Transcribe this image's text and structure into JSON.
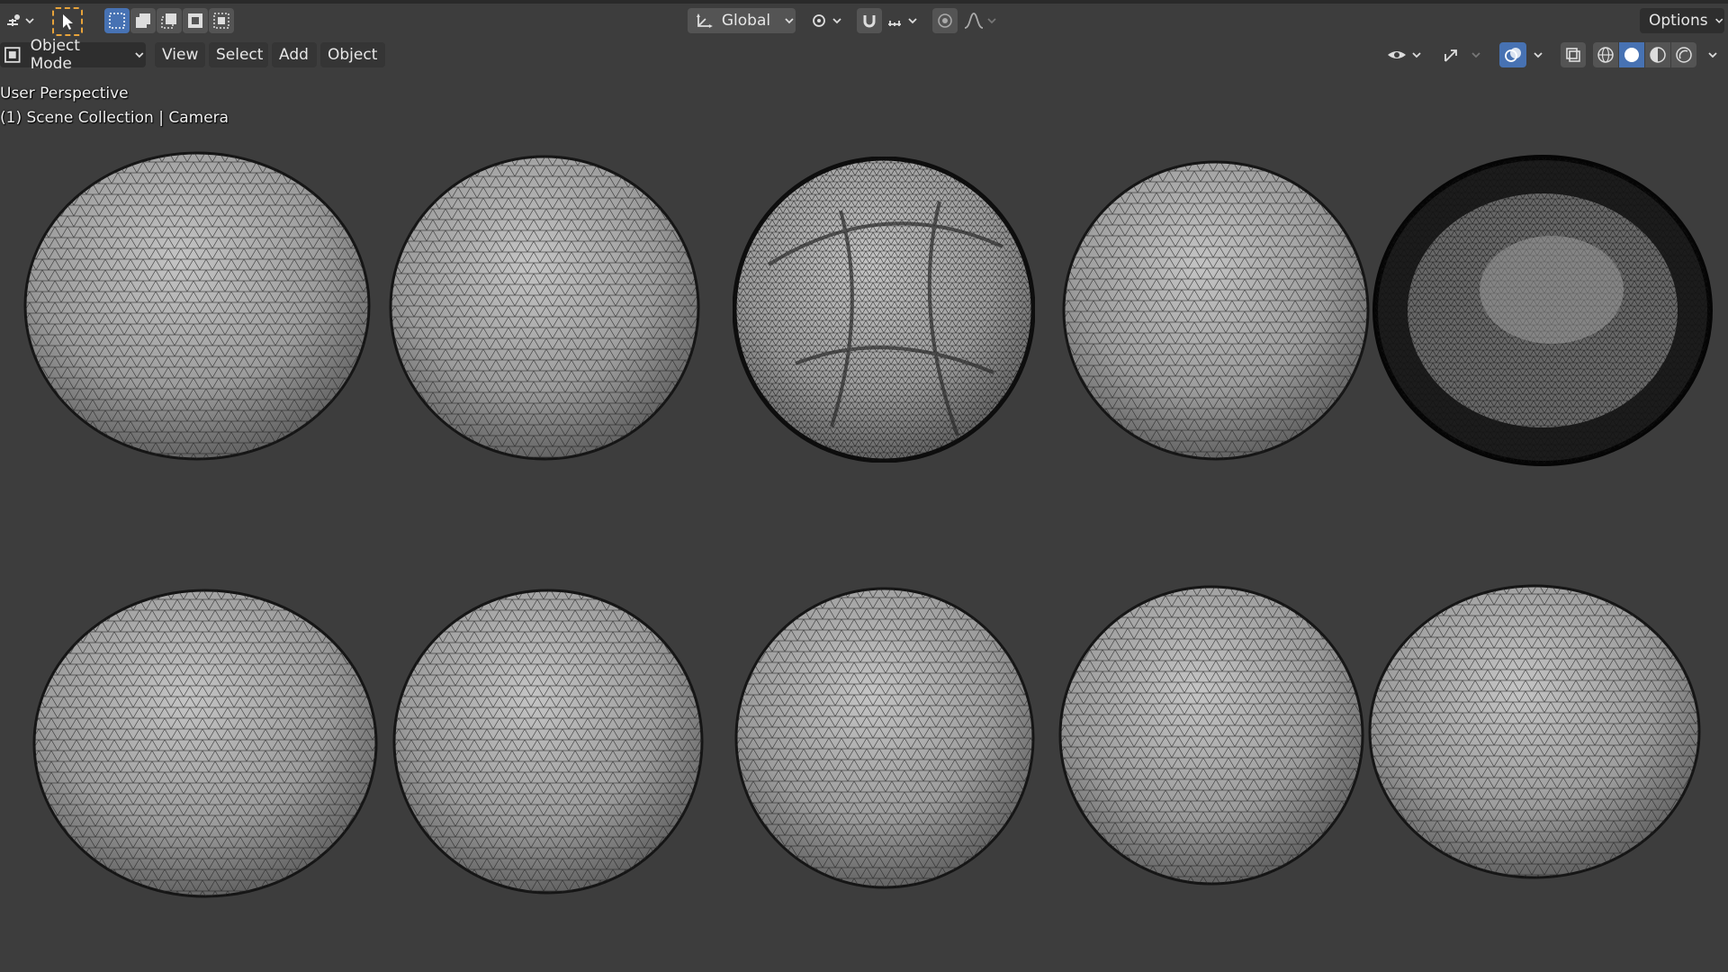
{
  "toolbar": {
    "transform_orientation": "Global",
    "options_label": "Options"
  },
  "header": {
    "mode": "Object Mode",
    "menus": [
      "View",
      "Select",
      "Add",
      "Object"
    ]
  },
  "viewport": {
    "perspective_label": "User Perspective",
    "collection_label": "(1) Scene Collection | Camera",
    "objects": [
      {
        "row": 1,
        "col": 1,
        "style": "smooth-wireframe"
      },
      {
        "row": 1,
        "col": 2,
        "style": "smooth-wireframe"
      },
      {
        "row": 1,
        "col": 3,
        "style": "cratered-wireframe"
      },
      {
        "row": 1,
        "col": 4,
        "style": "smooth-wireframe"
      },
      {
        "row": 1,
        "col": 5,
        "style": "noisy-wireframe"
      },
      {
        "row": 2,
        "col": 1,
        "style": "smooth-wireframe"
      },
      {
        "row": 2,
        "col": 2,
        "style": "smooth-wireframe"
      },
      {
        "row": 2,
        "col": 3,
        "style": "smooth-wireframe"
      },
      {
        "row": 2,
        "col": 4,
        "style": "smooth-wireframe"
      },
      {
        "row": 2,
        "col": 5,
        "style": "smooth-wireframe"
      }
    ]
  },
  "colors": {
    "background": "#3d3d3d",
    "accent": "#4772b3",
    "active_tool": "#e8a33a"
  }
}
